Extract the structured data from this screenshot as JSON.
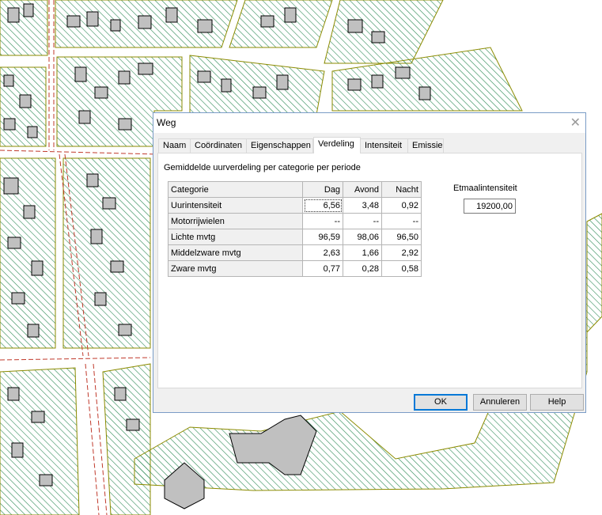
{
  "dialog": {
    "title": "Weg",
    "close_glyph": "✕",
    "tabs": [
      {
        "label": "Naam"
      },
      {
        "label": "Coördinaten"
      },
      {
        "label": "Eigenschappen"
      },
      {
        "label": "Verdeling"
      },
      {
        "label": "Intensiteit"
      },
      {
        "label": "Emissie"
      }
    ],
    "active_tab": "Verdeling",
    "panel_heading": "Gemiddelde uurverdeling per categorie per periode",
    "table": {
      "headers": [
        "Categorie",
        "Dag",
        "Avond",
        "Nacht"
      ],
      "rows": [
        [
          "Uurintensiteit",
          "6,56",
          "3,48",
          "0,92"
        ],
        [
          "Motorrijwielen",
          "--",
          "--",
          "--"
        ],
        [
          "Lichte mvtg",
          "96,59",
          "98,06",
          "96,50"
        ],
        [
          "Middelzware mvtg",
          "2,63",
          "1,66",
          "2,92"
        ],
        [
          "Zware mvtg",
          "0,77",
          "0,28",
          "0,58"
        ]
      ]
    },
    "etmaal": {
      "label": "Etmaalintensiteit",
      "value": "19200,00"
    },
    "buttons": {
      "ok": "OK",
      "cancel": "Annuleren",
      "help": "Help"
    }
  },
  "colors": {
    "map_hatch": "#2e8b57",
    "map_parcel_edge": "#8b8b00",
    "road_line": "#c0392b",
    "building_fill": "#c0c0c0",
    "dialog_border": "#7a9cc6",
    "default_button_border": "#0078d7"
  }
}
